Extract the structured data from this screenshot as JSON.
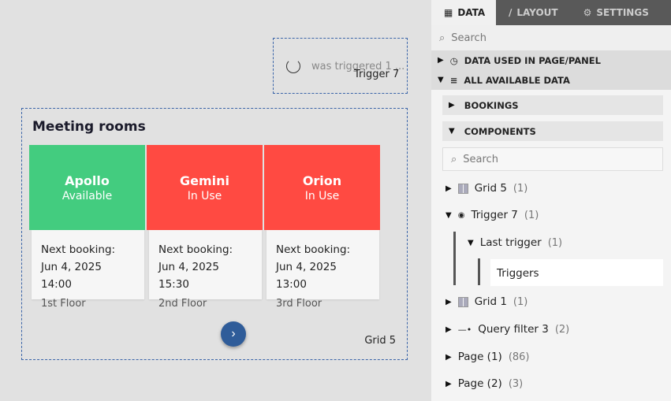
{
  "trigger": {
    "text": "was triggered 1 ...",
    "label": "Trigger 7"
  },
  "grid": {
    "title": "Meeting rooms",
    "label": "Grid 5",
    "next_icon": "chevron-right",
    "cards": [
      {
        "name": "Apollo",
        "status": "Available",
        "color": "#43cc7f",
        "next": "Next booking:",
        "date": "Jun 4, 2025 14:00",
        "floor": "1st Floor"
      },
      {
        "name": "Gemini",
        "status": "In Use",
        "color": "#ff4a42",
        "next": "Next booking:",
        "date": "Jun 4, 2025 15:30",
        "floor": "2nd Floor"
      },
      {
        "name": "Orion",
        "status": "In Use",
        "color": "#ff4a42",
        "next": "Next booking:",
        "date": "Jun 4, 2025 13:00",
        "floor": "3rd Floor"
      }
    ]
  },
  "panel": {
    "tabs": [
      "DATA",
      "LAYOUT",
      "SETTINGS"
    ],
    "search": "Search",
    "sections": [
      "DATA USED IN PAGE/PANEL",
      "ALL AVAILABLE DATA"
    ],
    "subs": [
      "BOOKINGS",
      "COMPONENTS"
    ],
    "comp_search": "Search",
    "tree": [
      {
        "label": "Grid 5",
        "count": "(1)"
      },
      {
        "label": "Trigger 7",
        "count": "(1)"
      },
      {
        "label": "Last trigger",
        "count": "(1)"
      },
      {
        "label": "Triggers"
      },
      {
        "label": "Grid 1",
        "count": "(1)"
      },
      {
        "label": "Query filter 3",
        "count": "(2)"
      },
      {
        "label": "Page (1)",
        "count": "(86)"
      },
      {
        "label": "Page (2)",
        "count": "(3)"
      }
    ]
  }
}
